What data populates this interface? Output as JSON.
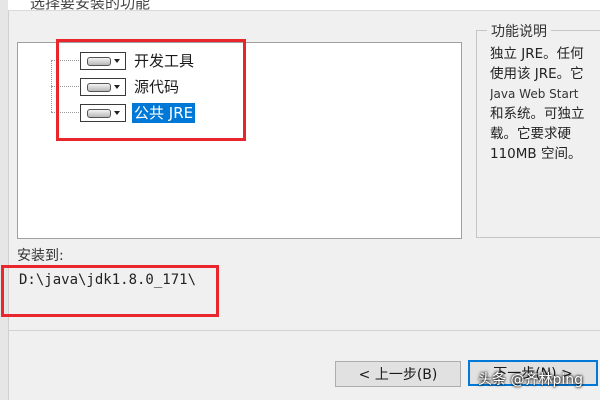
{
  "header": {
    "title": "选择要安装的功能"
  },
  "tree": {
    "items": [
      {
        "label": "开发工具",
        "selected": false
      },
      {
        "label": "源代码",
        "selected": false
      },
      {
        "label": "公共 JRE",
        "selected": true
      }
    ]
  },
  "feature_description": {
    "legend": "功能说明",
    "lines": [
      "独立 JRE。任何",
      "使用该 JRE。它",
      "Java Web Start",
      "和系统。可独立",
      "载。它要求硬",
      "110MB 空间。"
    ]
  },
  "install": {
    "label": "安装到:",
    "path": "D:\\java\\jdk1.8.0_171\\"
  },
  "buttons": {
    "back": "< 上一步(B)",
    "next": "下一步(N) >"
  },
  "watermark": "头条 @齐林ping",
  "colors": {
    "selection": "#0078d7",
    "highlight_box": "#e8262c"
  }
}
